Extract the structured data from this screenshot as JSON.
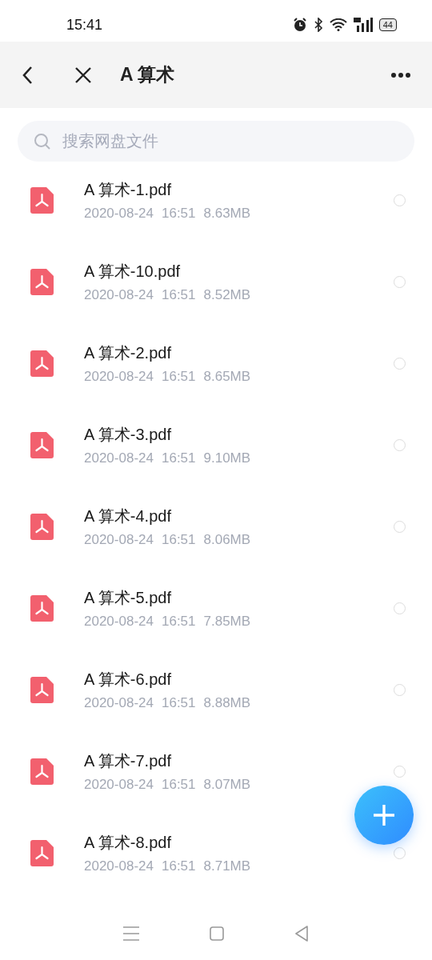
{
  "status_bar": {
    "time": "15:41",
    "battery": "44"
  },
  "header": {
    "title": "A 算术"
  },
  "search": {
    "placeholder": "搜索网盘文件"
  },
  "files": [
    {
      "name": "A 算术-1.pdf",
      "date": "2020-08-24",
      "time": "16:51",
      "size": "8.63MB",
      "selected": false
    },
    {
      "name": "A 算术-10.pdf",
      "date": "2020-08-24",
      "time": "16:51",
      "size": "8.52MB",
      "selected": false
    },
    {
      "name": "A 算术-2.pdf",
      "date": "2020-08-24",
      "time": "16:51",
      "size": "8.65MB",
      "selected": false
    },
    {
      "name": "A 算术-3.pdf",
      "date": "2020-08-24",
      "time": "16:51",
      "size": "9.10MB",
      "selected": false
    },
    {
      "name": "A 算术-4.pdf",
      "date": "2020-08-24",
      "time": "16:51",
      "size": "8.06MB",
      "selected": false
    },
    {
      "name": "A 算术-5.pdf",
      "date": "2020-08-24",
      "time": "16:51",
      "size": "7.85MB",
      "selected": false
    },
    {
      "name": "A 算术-6.pdf",
      "date": "2020-08-24",
      "time": "16:51",
      "size": "8.88MB",
      "selected": false
    },
    {
      "name": "A 算术-7.pdf",
      "date": "2020-08-24",
      "time": "16:51",
      "size": "8.07MB",
      "selected": false
    },
    {
      "name": "A 算术-8.pdf",
      "date": "2020-08-24",
      "time": "16:51",
      "size": "8.71MB",
      "selected": false
    }
  ]
}
